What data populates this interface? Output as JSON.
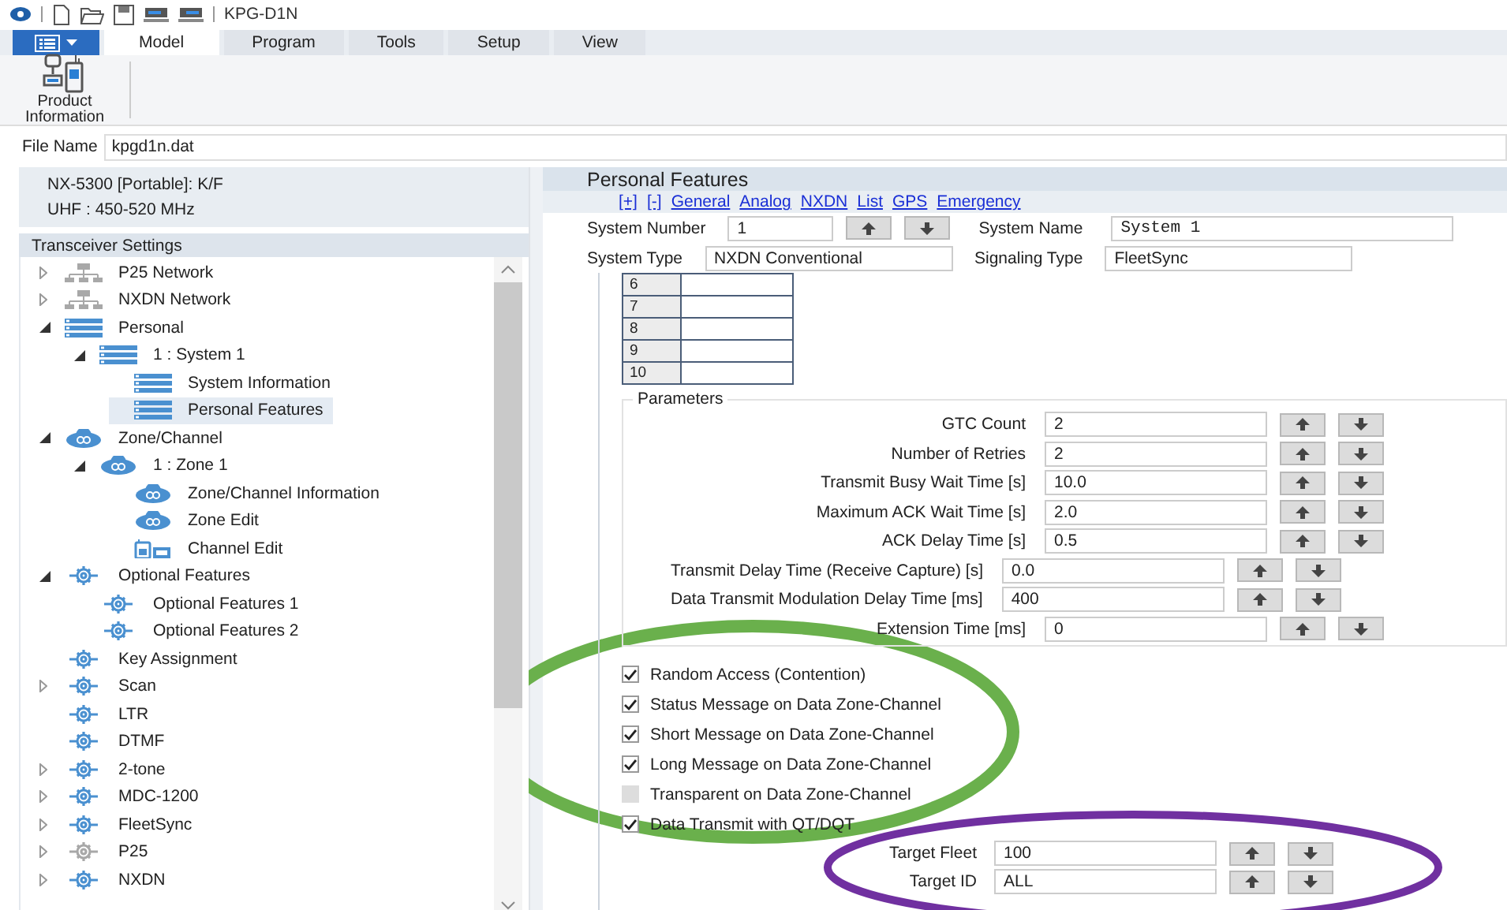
{
  "window": {
    "title": "KPG-D1N"
  },
  "ribbon_tabs": [
    {
      "label": "Model",
      "selected": true
    },
    {
      "label": "Program",
      "selected": false
    },
    {
      "label": "Tools",
      "selected": false
    },
    {
      "label": "Setup",
      "selected": false
    },
    {
      "label": "View",
      "selected": false
    }
  ],
  "ribbon_buttons": [
    {
      "label": "Product Information"
    }
  ],
  "file_name": {
    "label": "File Name",
    "value": "kpgd1n.dat"
  },
  "model_info": [
    "NX-5300 [Portable]: K/F",
    "UHF : 450-520 MHz"
  ],
  "tree": {
    "title": "Transceiver Settings",
    "items": [
      {
        "label": "P25 Network",
        "kind": "network",
        "expanded": false,
        "disabled": true,
        "selected": false
      },
      {
        "label": "NXDN Network",
        "kind": "network",
        "expanded": false,
        "disabled": true,
        "selected": false
      },
      {
        "label": "Personal",
        "kind": "list",
        "expanded": true,
        "disabled": false,
        "selected": false,
        "children": [
          {
            "label": "1 : System 1",
            "kind": "list",
            "expanded": true,
            "disabled": false,
            "selected": false,
            "children": [
              {
                "label": "System Information",
                "kind": "list",
                "disabled": false,
                "selected": false
              },
              {
                "label": "Personal Features",
                "kind": "list",
                "disabled": false,
                "selected": true
              }
            ]
          }
        ]
      },
      {
        "label": "Zone/Channel",
        "kind": "zone",
        "expanded": true,
        "disabled": false,
        "selected": false,
        "children": [
          {
            "label": "1 : Zone 1",
            "kind": "zone",
            "expanded": true,
            "disabled": false,
            "selected": false,
            "children": [
              {
                "label": "Zone/Channel Information",
                "kind": "zone",
                "disabled": false,
                "selected": false
              },
              {
                "label": "Zone Edit",
                "kind": "zone",
                "disabled": false,
                "selected": false
              },
              {
                "label": "Channel Edit",
                "kind": "channel",
                "disabled": false,
                "selected": false
              }
            ]
          }
        ]
      },
      {
        "label": "Optional Features",
        "kind": "gear",
        "expanded": true,
        "disabled": false,
        "selected": false,
        "children": [
          {
            "label": "Optional Features 1",
            "kind": "gear",
            "disabled": false,
            "selected": false
          },
          {
            "label": "Optional Features 2",
            "kind": "gear",
            "disabled": false,
            "selected": false
          }
        ]
      },
      {
        "label": "Key Assignment",
        "kind": "gear",
        "disabled": false,
        "selected": false
      },
      {
        "label": "Scan",
        "kind": "gear",
        "expanded": false,
        "disabled": false,
        "selected": false
      },
      {
        "label": "LTR",
        "kind": "gear",
        "disabled": false,
        "selected": false
      },
      {
        "label": "DTMF",
        "kind": "gear",
        "disabled": false,
        "selected": false
      },
      {
        "label": "2-tone",
        "kind": "gear",
        "expanded": false,
        "disabled": false,
        "selected": false
      },
      {
        "label": "MDC-1200",
        "kind": "gear",
        "expanded": false,
        "disabled": false,
        "selected": false
      },
      {
        "label": "FleetSync",
        "kind": "gear",
        "expanded": false,
        "disabled": false,
        "selected": false
      },
      {
        "label": "P25",
        "kind": "gear",
        "expanded": false,
        "disabled": true,
        "selected": false
      },
      {
        "label": "NXDN",
        "kind": "gear",
        "expanded": false,
        "disabled": false,
        "selected": false
      }
    ]
  },
  "panel": {
    "title": "Personal Features",
    "links": [
      "[+]",
      "[-]",
      "General",
      "Analog",
      "NXDN",
      "List",
      "GPS",
      "Emergency"
    ],
    "system_number": {
      "label": "System Number",
      "value": "1"
    },
    "system_name": {
      "label": "System Name",
      "value": "System 1"
    },
    "system_type": {
      "label": "System Type",
      "value": "NXDN Conventional"
    },
    "signaling_type": {
      "label": "Signaling Type",
      "value": "FleetSync"
    },
    "table_rows": [
      "6",
      "7",
      "8",
      "9",
      "10"
    ],
    "parameters": {
      "title": "Parameters",
      "rows": [
        {
          "label": "GTC Count",
          "value": "2",
          "kind": "short"
        },
        {
          "label": "Number of Retries",
          "value": "2",
          "kind": "short"
        },
        {
          "label": "Transmit Busy Wait Time [s]",
          "value": "10.0",
          "kind": "short"
        },
        {
          "label": "Maximum ACK Wait Time [s]",
          "value": "2.0",
          "kind": "short"
        },
        {
          "label": "ACK Delay Time [s]",
          "value": "0.5",
          "kind": "short"
        },
        {
          "label": "Transmit Delay Time (Receive Capture) [s]",
          "value": "0.0",
          "kind": "long"
        },
        {
          "label": "Data Transmit Modulation Delay Time [ms]",
          "value": "400",
          "kind": "long"
        },
        {
          "label": "Extension Time [ms]",
          "value": "0",
          "kind": "short"
        }
      ]
    },
    "checkboxes": [
      {
        "label": "Random Access (Contention)",
        "checked": true,
        "disabled": false
      },
      {
        "label": "Status Message on Data Zone-Channel",
        "checked": true,
        "disabled": false
      },
      {
        "label": "Short Message on Data Zone-Channel",
        "checked": true,
        "disabled": false
      },
      {
        "label": "Long Message on Data Zone-Channel",
        "checked": true,
        "disabled": false
      },
      {
        "label": "Transparent on Data Zone-Channel",
        "checked": false,
        "disabled": true
      },
      {
        "label": "Data Transmit with QT/DQT",
        "checked": true,
        "disabled": false
      }
    ],
    "targets": [
      {
        "label": "Target Fleet",
        "value": "100"
      },
      {
        "label": "Target ID",
        "value": "ALL"
      }
    ]
  },
  "annotations": [
    {
      "kind": "ellipse",
      "color": "#6ab04c"
    },
    {
      "kind": "ellipse",
      "color": "#7030a0"
    }
  ]
}
